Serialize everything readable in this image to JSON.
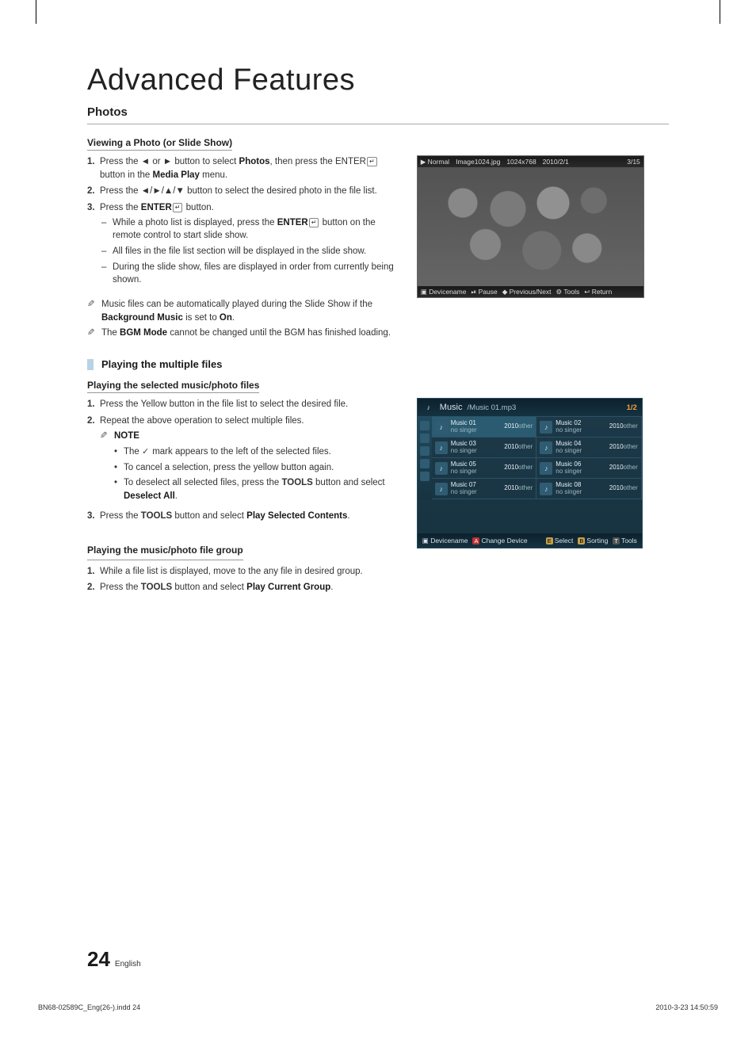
{
  "page": {
    "title": "Advanced Features",
    "section": "Photos",
    "number": "24",
    "language": "English",
    "bleed_left": "BN68-02589C_Eng(26-).indd   24",
    "bleed_right": "2010-3-23   14:50:59"
  },
  "sub1": {
    "heading": "Viewing a Photo (or Slide Show)",
    "step1_pre": "Press the ◄ or ► button to select ",
    "step1_b1": "Photos",
    "step1_mid": ", then press the ENTER",
    "step1_after_enter": " button in the ",
    "step1_b2": "Media Play",
    "step1_end": " menu.",
    "step2": "Press the ◄/►/▲/▼ button to select the desired photo in the file list.",
    "step3_pre": "Press the ",
    "step3_b": "ENTER",
    "step3_end": " button.",
    "dash1_pre": "While a photo list is displayed, press the ",
    "dash1_b": "ENTER",
    "dash1_end": " button on the remote control to start slide show.",
    "dash2": "All files in the file list section will be displayed in the slide show.",
    "dash3": "During the slide show, files are displayed in order from currently being shown.",
    "note1_pre": "Music files can be automatically played during the Slide Show if the ",
    "note1_b1": "Background Music",
    "note1_mid": " is set to ",
    "note1_b2": "On",
    "note1_end": ".",
    "note2_pre": "The ",
    "note2_b": "BGM Mode",
    "note2_end": " cannot be changed until the BGM has finished loading."
  },
  "photo_shot": {
    "mode": "▶ Normal",
    "filename": "Image1024.jpg",
    "resolution": "1024x768",
    "date": "2010/2/1",
    "index": "3/15",
    "device": "Devicename",
    "pause": "Pause",
    "prevnext": "Previous/Next",
    "tools": "Tools",
    "return": "Return"
  },
  "bar": {
    "title": "Playing the multiple files"
  },
  "sub2": {
    "heading": "Playing the selected music/photo files",
    "step1": "Press the Yellow button in the file list to select the desired file.",
    "step2": "Repeat the above operation to select multiple files.",
    "note_label": "NOTE",
    "b1_pre": "The ",
    "b1_end": " mark appears to the left of the selected files.",
    "b2": "To cancel a selection, press the yellow button again.",
    "b3_pre": "To deselect all selected files, press the ",
    "b3_tools": "TOOLS",
    "b3_mid": " button and select ",
    "b3_b": "Deselect All",
    "b3_end": ".",
    "step3_pre": "Press the ",
    "step3_tools": "TOOLS",
    "step3_mid": " button and select ",
    "step3_b": "Play Selected Contents",
    "step3_end": "."
  },
  "music_shot": {
    "title_icon": "♪",
    "title": "Music",
    "path": "/Music 01.mp3",
    "count": "1/2",
    "items": [
      {
        "t": "Music 01",
        "s": "no singer",
        "y": "2010",
        "o": "other"
      },
      {
        "t": "Music 02",
        "s": "no singer",
        "y": "2010",
        "o": "other"
      },
      {
        "t": "Music 03",
        "s": "no singer",
        "y": "2010",
        "o": "other"
      },
      {
        "t": "Music 04",
        "s": "no singer",
        "y": "2010",
        "o": "other"
      },
      {
        "t": "Music 05",
        "s": "no singer",
        "y": "2010",
        "o": "other"
      },
      {
        "t": "Music 06",
        "s": "no singer",
        "y": "2010",
        "o": "other"
      },
      {
        "t": "Music 07",
        "s": "no singer",
        "y": "2010",
        "o": "other"
      },
      {
        "t": "Music 08",
        "s": "no singer",
        "y": "2010",
        "o": "other"
      }
    ],
    "bot_device": "Devicename",
    "bot_change": "Change Device",
    "bot_select": "Select",
    "bot_sorting": "Sorting",
    "bot_tools": "Tools"
  },
  "sub3": {
    "heading": "Playing the music/photo file group",
    "step1": "While a file list is displayed, move to the any file in desired group.",
    "step2_pre": "Press the ",
    "step2_tools": "TOOLS",
    "step2_mid": " button and select ",
    "step2_b": "Play Current Group",
    "step2_end": "."
  }
}
